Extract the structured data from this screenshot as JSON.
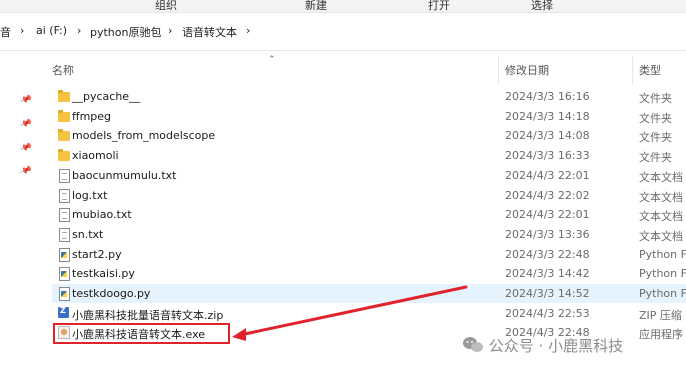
{
  "ribbon": {
    "items": [
      "组织",
      "新建",
      "打开",
      "选择"
    ]
  },
  "address": {
    "segments": [
      "音",
      "ai (F:)",
      "python原驰包",
      "语音转文本"
    ],
    "separator": "›"
  },
  "columns": {
    "name": "名称",
    "modified": "修改日期",
    "type": "类型"
  },
  "files": [
    {
      "name": "__pycache__",
      "date": "2024/3/3 16:16",
      "type": "文件夹",
      "icon": "folder-icon"
    },
    {
      "name": "ffmpeg",
      "date": "2024/3/3 14:18",
      "type": "文件夹",
      "icon": "folder-icon"
    },
    {
      "name": "models_from_modelscope",
      "date": "2024/3/3 14:08",
      "type": "文件夹",
      "icon": "folder-icon"
    },
    {
      "name": "xiaomoli",
      "date": "2024/3/3 16:33",
      "type": "文件夹",
      "icon": "folder-icon"
    },
    {
      "name": "baocunmumulu.txt",
      "date": "2024/4/3 22:01",
      "type": "文本文档",
      "icon": "text-file-icon"
    },
    {
      "name": "log.txt",
      "date": "2024/4/3 22:02",
      "type": "文本文档",
      "icon": "text-file-icon"
    },
    {
      "name": "mubiao.txt",
      "date": "2024/4/3 22:01",
      "type": "文本文档",
      "icon": "text-file-icon"
    },
    {
      "name": "sn.txt",
      "date": "2024/3/3 13:36",
      "type": "文本文档",
      "icon": "text-file-icon"
    },
    {
      "name": "start2.py",
      "date": "2024/3/3 22:48",
      "type": "Python F",
      "icon": "python-file-icon"
    },
    {
      "name": "testkaisi.py",
      "date": "2024/3/3 14:42",
      "type": "Python F",
      "icon": "python-file-icon"
    },
    {
      "name": "testkdoogo.py",
      "date": "2024/3/3 14:52",
      "type": "Python F",
      "icon": "python-file-icon",
      "selected": true
    },
    {
      "name": "小鹿黑科技批量语音转文本.zip",
      "date": "2024/4/3 22:53",
      "type": "ZIP 压缩",
      "icon": "zip-file-icon"
    },
    {
      "name": "小鹿黑科技语音转文本.exe",
      "date": "2024/4/3 22:48",
      "type": "应用程序",
      "icon": "exe-file-icon",
      "highlighted": true
    }
  ],
  "watermark": "公众号 · 小鹿黑科技",
  "colors": {
    "annotation": "#e0222c",
    "selected_row": "#e5f3ff",
    "folder": "#f5c342"
  }
}
